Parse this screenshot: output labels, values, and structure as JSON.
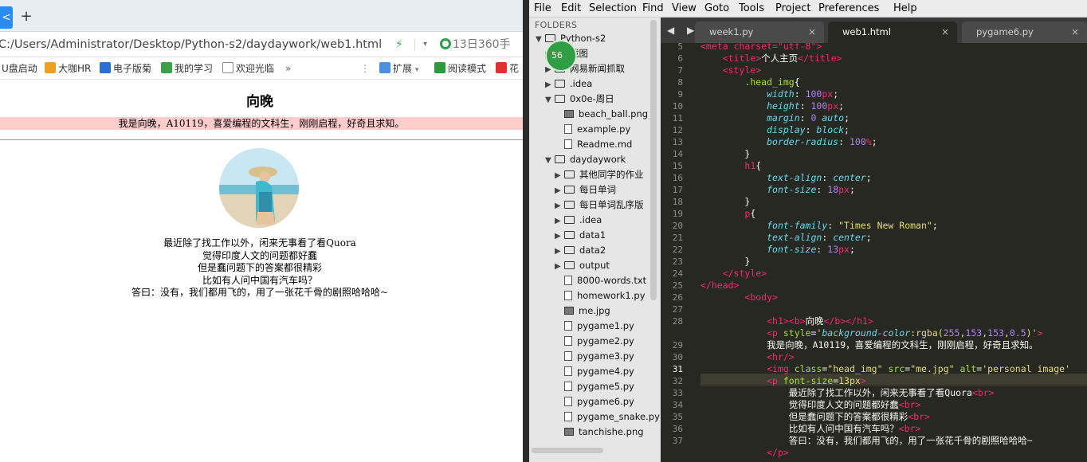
{
  "browser": {
    "active_tab_glyph": "<",
    "new_tab": "+",
    "url": "C:/Users/Administrator/Desktop/Python-s2/daydaywork/web1.html",
    "search_text": "13日360手",
    "bookmarks": [
      "U盘启动",
      "大咖HR",
      "电子版菊",
      "我的学习",
      "欢迎光临",
      "»",
      "扩展",
      "阅读模式",
      "花"
    ],
    "page": {
      "title": "向晚",
      "intro": "我是向晚，A10119，喜爱编程的文科生，刚刚启程，好奇且求知。",
      "poem": [
        "最近除了找工作以外，闲来无事看了看Quora",
        "觉得印度人文的问题都好蠢",
        "但是蠢问题下的答案都很精彩",
        "比如有人问中国有汽车吗？",
        "答曰：没有，我们都用飞的，用了一张花千骨的剧照哈哈哈~"
      ]
    }
  },
  "editor": {
    "menu": [
      "File",
      "Edit",
      "Selection",
      "Find",
      "View",
      "Goto",
      "Tools",
      "Project",
      "Preferences",
      "Help"
    ],
    "sidebar": {
      "label": "FOLDERS",
      "items": [
        {
          "label": "Python-s2",
          "kind": "folder-open",
          "depth": 0
        },
        {
          "label": "截图",
          "kind": "folder",
          "depth": 1
        },
        {
          "label": "网易新闻抓取",
          "kind": "folder",
          "depth": 1
        },
        {
          "label": ".idea",
          "kind": "folder",
          "depth": 1
        },
        {
          "label": "0x0e-周日",
          "kind": "folder-open",
          "depth": 1
        },
        {
          "label": "beach_ball.png",
          "kind": "image",
          "depth": 2
        },
        {
          "label": "example.py",
          "kind": "file",
          "depth": 2
        },
        {
          "label": "Readme.md",
          "kind": "file",
          "depth": 2
        },
        {
          "label": "daydaywork",
          "kind": "folder-open",
          "depth": 1
        },
        {
          "label": "其他同学的作业",
          "kind": "folder",
          "depth": 2
        },
        {
          "label": "每日单词",
          "kind": "folder",
          "depth": 2
        },
        {
          "label": "每日单词乱序版",
          "kind": "folder",
          "depth": 2
        },
        {
          "label": ".idea",
          "kind": "folder",
          "depth": 2
        },
        {
          "label": "data1",
          "kind": "folder",
          "depth": 2
        },
        {
          "label": "data2",
          "kind": "folder",
          "depth": 2
        },
        {
          "label": "output",
          "kind": "folder",
          "depth": 2
        },
        {
          "label": "8000-words.txt",
          "kind": "file",
          "depth": 2
        },
        {
          "label": "homework1.py",
          "kind": "file",
          "depth": 2
        },
        {
          "label": "me.jpg",
          "kind": "image",
          "depth": 2
        },
        {
          "label": "pygame1.py",
          "kind": "file",
          "depth": 2
        },
        {
          "label": "pygame2.py",
          "kind": "file",
          "depth": 2
        },
        {
          "label": "pygame3.py",
          "kind": "file",
          "depth": 2
        },
        {
          "label": "pygame4.py",
          "kind": "file",
          "depth": 2
        },
        {
          "label": "pygame5.py",
          "kind": "file",
          "depth": 2
        },
        {
          "label": "pygame6.py",
          "kind": "file",
          "depth": 2
        },
        {
          "label": "pygame_snake.py",
          "kind": "file",
          "depth": 2
        },
        {
          "label": "tanchishe.png",
          "kind": "image",
          "depth": 2
        }
      ]
    },
    "tabs": [
      {
        "label": "week1.py",
        "active": false
      },
      {
        "label": "web1.html",
        "active": true
      },
      {
        "label": "pygame6.py",
        "active": false
      }
    ],
    "tab_close": "×",
    "nav_arrows": "◀ ▶",
    "badge": "56",
    "line_numbers": [
      "5",
      "6",
      "7",
      "8",
      "9",
      "10",
      "11",
      "12",
      "13",
      "14",
      "15",
      "16",
      "17",
      "18",
      "19",
      "20",
      "21",
      "22",
      "23",
      "24",
      "25",
      "26",
      "27",
      "28",
      "",
      "29",
      "30",
      "31",
      "32",
      "33",
      "34",
      "35",
      "36",
      "37"
    ],
    "current_line": "31",
    "code_lines": [
      [
        [
          "t",
          "<meta charset=\"utf-8\">"
        ]
      ],
      [
        [
          "w",
          "    "
        ],
        [
          "t",
          "<title>"
        ],
        [
          "w",
          "个人主页"
        ],
        [
          "t",
          "</title>"
        ]
      ],
      [
        [
          "w",
          "    "
        ],
        [
          "t",
          "<style>"
        ]
      ],
      [
        [
          "w",
          "        "
        ],
        [
          "a",
          ".head_img"
        ],
        [
          "w",
          "{"
        ]
      ],
      [
        [
          "w",
          "            "
        ],
        [
          "p",
          "width"
        ],
        [
          "w",
          ": "
        ],
        [
          "n",
          "100"
        ],
        [
          "t",
          "px"
        ],
        [
          "w",
          ";"
        ]
      ],
      [
        [
          "w",
          "            "
        ],
        [
          "p",
          "height"
        ],
        [
          "w",
          ": "
        ],
        [
          "n",
          "100"
        ],
        [
          "t",
          "px"
        ],
        [
          "w",
          ";"
        ]
      ],
      [
        [
          "w",
          "            "
        ],
        [
          "p",
          "margin"
        ],
        [
          "w",
          ": "
        ],
        [
          "n",
          "0"
        ],
        [
          "w",
          " "
        ],
        [
          "p",
          "auto"
        ],
        [
          "w",
          ";"
        ]
      ],
      [
        [
          "w",
          "            "
        ],
        [
          "p",
          "display"
        ],
        [
          "w",
          ": "
        ],
        [
          "p",
          "block"
        ],
        [
          "w",
          ";"
        ]
      ],
      [
        [
          "w",
          "            "
        ],
        [
          "p",
          "border-radius"
        ],
        [
          "w",
          ": "
        ],
        [
          "n",
          "100"
        ],
        [
          "t",
          "%"
        ],
        [
          "w",
          ";"
        ]
      ],
      [
        [
          "w",
          "        }"
        ]
      ],
      [
        [
          "w",
          "        "
        ],
        [
          "t",
          "h1"
        ],
        [
          "w",
          "{"
        ]
      ],
      [
        [
          "w",
          "            "
        ],
        [
          "p",
          "text-align"
        ],
        [
          "w",
          ": "
        ],
        [
          "p",
          "center"
        ],
        [
          "w",
          ";"
        ]
      ],
      [
        [
          "w",
          "            "
        ],
        [
          "p",
          "font-size"
        ],
        [
          "w",
          ": "
        ],
        [
          "n",
          "18"
        ],
        [
          "t",
          "px"
        ],
        [
          "w",
          ";"
        ]
      ],
      [
        [
          "w",
          "        }"
        ]
      ],
      [
        [
          "w",
          "        "
        ],
        [
          "t",
          "p"
        ],
        [
          "w",
          "{"
        ]
      ],
      [
        [
          "w",
          "            "
        ],
        [
          "p",
          "font-family"
        ],
        [
          "w",
          ": "
        ],
        [
          "s",
          "\"Times New Roman\""
        ],
        [
          "w",
          ";"
        ]
      ],
      [
        [
          "w",
          "            "
        ],
        [
          "p",
          "text-align"
        ],
        [
          "w",
          ": "
        ],
        [
          "p",
          "center"
        ],
        [
          "w",
          ";"
        ]
      ],
      [
        [
          "w",
          "            "
        ],
        [
          "p",
          "font-size"
        ],
        [
          "w",
          ": "
        ],
        [
          "n",
          "13"
        ],
        [
          "t",
          "px"
        ],
        [
          "w",
          ";"
        ]
      ],
      [
        [
          "w",
          "        }"
        ]
      ],
      [
        [
          "w",
          "    "
        ],
        [
          "t",
          "</style>"
        ]
      ],
      [
        [
          "t",
          "</head>"
        ]
      ],
      [
        [
          "w",
          "        "
        ],
        [
          "t",
          "<body>"
        ]
      ],
      [
        [
          "w",
          ""
        ]
      ],
      [
        [
          "w",
          "            "
        ],
        [
          "t",
          "<h1><b>"
        ],
        [
          "w",
          "向晚"
        ],
        [
          "t",
          "</b></h1>"
        ]
      ],
      [
        [
          "w",
          "            "
        ],
        [
          "t",
          "<p "
        ],
        [
          "a",
          "style"
        ],
        [
          "w",
          "="
        ],
        [
          "s",
          "'"
        ],
        [
          "p",
          "background-color"
        ],
        [
          "s",
          ":rgba("
        ],
        [
          "n",
          "255"
        ],
        [
          "s",
          ","
        ],
        [
          "n",
          "153"
        ],
        [
          "s",
          ","
        ],
        [
          "n",
          "153"
        ],
        [
          "s",
          ","
        ],
        [
          "n",
          "0.5"
        ],
        [
          "s",
          ")'"
        ],
        [
          "t",
          ">"
        ]
      ],
      [
        [
          "w",
          "            我是向晚，A10119，喜爱编程的文科生，刚刚启程，好奇且求知。"
        ]
      ],
      [
        [
          "w",
          "            "
        ],
        [
          "t",
          "<hr/>"
        ]
      ],
      [
        [
          "w",
          "            "
        ],
        [
          "t",
          "<img "
        ],
        [
          "a",
          "class"
        ],
        [
          "w",
          "="
        ],
        [
          "s",
          "\"head_img\""
        ],
        [
          "w",
          " "
        ],
        [
          "a",
          "src"
        ],
        [
          "w",
          "="
        ],
        [
          "s",
          "\"me.jpg\""
        ],
        [
          "w",
          " "
        ],
        [
          "a",
          "alt"
        ],
        [
          "w",
          "="
        ],
        [
          "s",
          "'personal image'"
        ]
      ],
      [
        [
          "w",
          "            "
        ],
        [
          "t",
          "<p "
        ],
        [
          "a",
          "font-size"
        ],
        [
          "w",
          "="
        ],
        [
          "s",
          "13px"
        ],
        [
          "t",
          ">"
        ]
      ],
      [
        [
          "w",
          "                最近除了找工作以外，闲来无事看了看Quora"
        ],
        [
          "t",
          "<br>"
        ]
      ],
      [
        [
          "w",
          "                觉得印度人文的问题都好蠢"
        ],
        [
          "t",
          "<br>"
        ]
      ],
      [
        [
          "w",
          "                但是蠢问题下的答案都很精彩"
        ],
        [
          "t",
          "<br>"
        ]
      ],
      [
        [
          "w",
          "                比如有人问中国有汽车吗？"
        ],
        [
          "t",
          "<br>"
        ]
      ],
      [
        [
          "w",
          "                答曰：没有，我们都用飞的，用了一张花千骨的剧照哈哈哈~"
        ]
      ],
      [
        [
          "w",
          "            "
        ],
        [
          "t",
          "</p>"
        ]
      ]
    ],
    "colors": {
      "background": "#272822",
      "tag": "#f92672",
      "string": "#e6db74",
      "attr": "#a6e22e",
      "property": "#66d9ef",
      "number": "#ae81ff"
    }
  }
}
